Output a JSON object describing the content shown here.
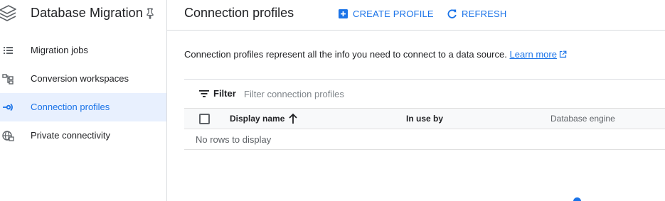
{
  "sidebar": {
    "product_title": "Database Migration",
    "items": [
      {
        "label": "Migration jobs",
        "icon": "list-icon",
        "active": false
      },
      {
        "label": "Conversion workspaces",
        "icon": "workspace-icon",
        "active": false
      },
      {
        "label": "Connection profiles",
        "icon": "connection-icon",
        "active": true
      },
      {
        "label": "Private connectivity",
        "icon": "globe-network-icon",
        "active": false
      }
    ]
  },
  "header": {
    "title": "Connection profiles",
    "create_label": "CREATE PROFILE",
    "refresh_label": "REFRESH"
  },
  "main": {
    "description": "Connection profiles represent all the info you need to connect to a data source.",
    "learn_more": "Learn more"
  },
  "table": {
    "filter_label": "Filter",
    "filter_placeholder": "Filter connection profiles",
    "columns": [
      "Display name",
      "In use by",
      "Database engine"
    ],
    "empty_text": "No rows to display"
  },
  "colors": {
    "accent": "#1a73e8",
    "active_bg": "#e8f0fe",
    "text": "#202124",
    "muted": "#5f6368"
  }
}
